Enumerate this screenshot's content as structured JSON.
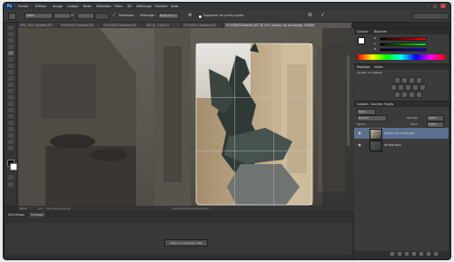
{
  "app": {
    "logo": "Ps"
  },
  "menu": [
    "Fichier",
    "Édition",
    "Image",
    "Calque",
    "Texte",
    "Sélection",
    "Filtre",
    "3D",
    "Affichage",
    "Fenêtre",
    "Aide"
  ],
  "window_controls": [
    "–",
    "□",
    "×"
  ],
  "options_bar": {
    "field1": "Libre",
    "redresser_label": "Redresser",
    "affichage_label": "Affichage :",
    "affichage_value": "Règle des t...",
    "supprimer_label": "Supprimer les pixels rognés",
    "cancel_icon": "⊘",
    "commit_icon": "✓"
  },
  "tabs": [
    {
      "label": "IMG_3442 Modifier.JPG"
    },
    {
      "label": "P1040903-Modifier.JPG"
    },
    {
      "label": "P1040905-Modifier.JPG"
    },
    {
      "label": "DSC01_3346.tif"
    },
    {
      "label": "P1040901-Modifier.JPG"
    },
    {
      "label": "P1040903-Modifier.JPG @ 25% (Aperçu du recadrage, RGB/8)",
      "active": true
    }
  ],
  "status": {
    "zoom": "25 %",
    "doc": "Doc : 51,4 Mo/102,8 Mo"
  },
  "timeline": {
    "tabs": [
      "Mini Bridge",
      "Montage"
    ],
    "button": "Créer un montage vidéo"
  },
  "panels": {
    "color": {
      "tabs": [
        "Couleur",
        "Nuancier"
      ],
      "channels": [
        "R",
        "V",
        "B"
      ]
    },
    "adjustments": {
      "tabs": [
        "Réglages",
        "Styles"
      ],
      "subtitle": "Ajouter un réglage"
    },
    "layers": {
      "tabs": [
        "Calques",
        "Couches",
        "Tracés"
      ],
      "filter": "Type",
      "blend_mode": "Normal",
      "opacity_label": "Opacité :",
      "opacity_value": "100%",
      "lock_label": "Verrou :",
      "fill_label": "Fond :",
      "fill_value": "100%",
      "items": [
        {
          "name": "Aperçu du recadrage",
          "selected": true
        },
        {
          "name": "Arrière-plan",
          "selected": false
        }
      ]
    }
  },
  "colors": {
    "accent": "#5a7aa8",
    "selected_layer": "#5b6f8f"
  }
}
